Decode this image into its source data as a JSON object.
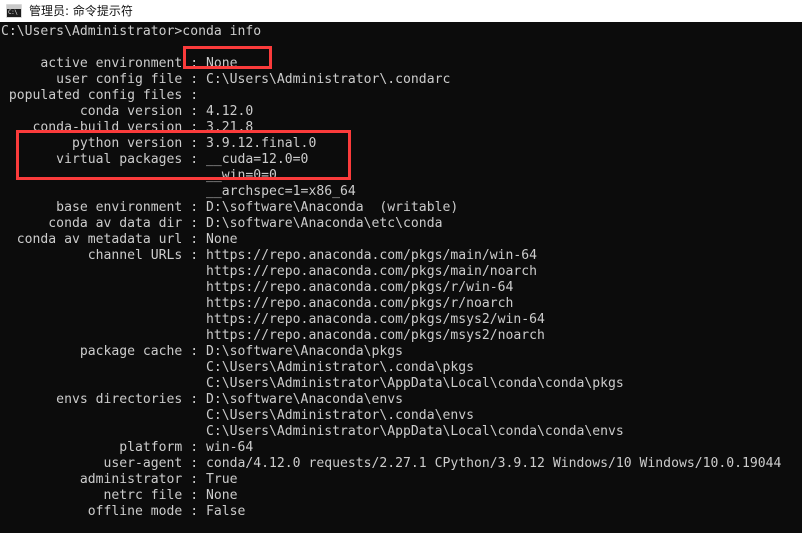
{
  "window": {
    "title": "管理员: 命令提示符",
    "icon": "command-prompt-icon",
    "icon_glyph": "C:\\",
    "titlebar_bg": "#ffffff",
    "titlebar_fg": "#141414"
  },
  "terminal": {
    "background": "#0c0c0c",
    "foreground": "#cccccc",
    "prompt": "C:\\Users\\Administrator>",
    "command": "conda info",
    "output_lines": [
      "C:\\Users\\Administrator>conda info",
      "",
      "     active environment : None",
      "       user config file : C:\\Users\\Administrator\\.condarc",
      " populated config files :",
      "          conda version : 4.12.0",
      "    conda-build version : 3.21.8",
      "         python version : 3.9.12.final.0",
      "       virtual packages : __cuda=12.0=0",
      "                          __win=0=0",
      "                          __archspec=1=x86_64",
      "       base environment : D:\\software\\Anaconda  (writable)",
      "      conda av data dir : D:\\software\\Anaconda\\etc\\conda",
      "  conda av metadata url : None",
      "           channel URLs : https://repo.anaconda.com/pkgs/main/win-64",
      "                          https://repo.anaconda.com/pkgs/main/noarch",
      "                          https://repo.anaconda.com/pkgs/r/win-64",
      "                          https://repo.anaconda.com/pkgs/r/noarch",
      "                          https://repo.anaconda.com/pkgs/msys2/win-64",
      "                          https://repo.anaconda.com/pkgs/msys2/noarch",
      "          package cache : D:\\software\\Anaconda\\pkgs",
      "                          C:\\Users\\Administrator\\.conda\\pkgs",
      "                          C:\\Users\\Administrator\\AppData\\Local\\conda\\conda\\pkgs",
      "       envs directories : D:\\software\\Anaconda\\envs",
      "                          C:\\Users\\Administrator\\.conda\\envs",
      "                          C:\\Users\\Administrator\\AppData\\Local\\conda\\conda\\envs",
      "               platform : win-64",
      "             user-agent : conda/4.12.0 requests/2.27.1 CPython/3.9.12 Windows/10 Windows/10.0.19044",
      "          administrator : True",
      "             netrc file : None",
      "           offline mode : False"
    ],
    "fields": {
      "active_environment": "None",
      "user_config_file": "C:\\Users\\Administrator\\.condarc",
      "populated_config_files": "",
      "conda_version": "4.12.0",
      "conda_build_version": "3.21.8",
      "python_version": "3.9.12.final.0",
      "virtual_packages": [
        "__cuda=12.0=0",
        "__win=0=0",
        "__archspec=1=x86_64"
      ],
      "base_environment": "D:\\software\\Anaconda  (writable)",
      "conda_av_data_dir": "D:\\software\\Anaconda\\etc\\conda",
      "conda_av_metadata_url": "None",
      "channel_urls": [
        "https://repo.anaconda.com/pkgs/main/win-64",
        "https://repo.anaconda.com/pkgs/main/noarch",
        "https://repo.anaconda.com/pkgs/r/win-64",
        "https://repo.anaconda.com/pkgs/r/noarch",
        "https://repo.anaconda.com/pkgs/msys2/win-64",
        "https://repo.anaconda.com/pkgs/msys2/noarch"
      ],
      "package_cache": [
        "D:\\software\\Anaconda\\pkgs",
        "C:\\Users\\Administrator\\.conda\\pkgs",
        "C:\\Users\\Administrator\\AppData\\Local\\conda\\conda\\pkgs"
      ],
      "envs_directories": [
        "D:\\software\\Anaconda\\envs",
        "C:\\Users\\Administrator\\.conda\\envs",
        "C:\\Users\\Administrator\\AppData\\Local\\conda\\conda\\envs"
      ],
      "platform": "win-64",
      "user_agent": "conda/4.12.0 requests/2.27.1 CPython/3.9.12 Windows/10 Windows/10.0.19044",
      "administrator": "True",
      "netrc_file": "None",
      "offline_mode": "False"
    }
  },
  "annotations": {
    "color": "#fb3b3b",
    "boxes": [
      {
        "name": "command-highlight",
        "target": "conda info"
      },
      {
        "name": "versions-highlight",
        "target": "conda version / conda-build version / python version"
      }
    ]
  }
}
